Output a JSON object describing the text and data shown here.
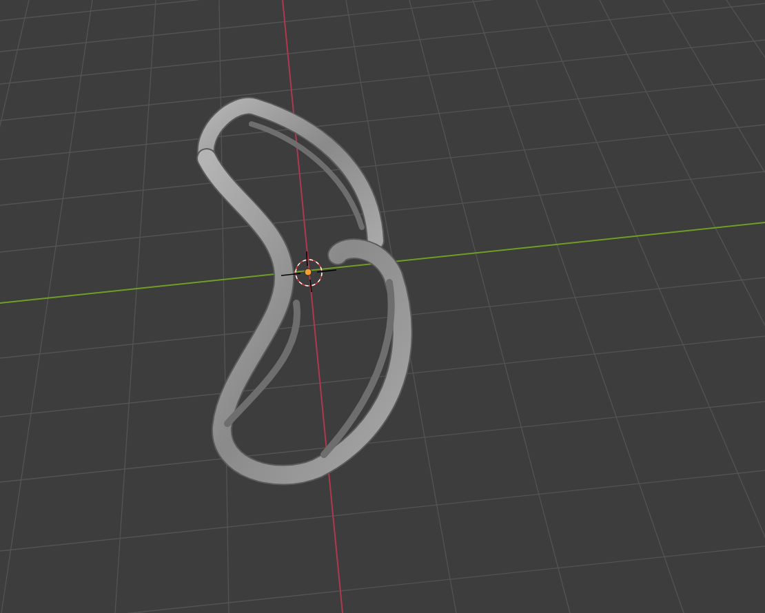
{
  "viewport": {
    "object": {
      "selected": false
    }
  }
}
